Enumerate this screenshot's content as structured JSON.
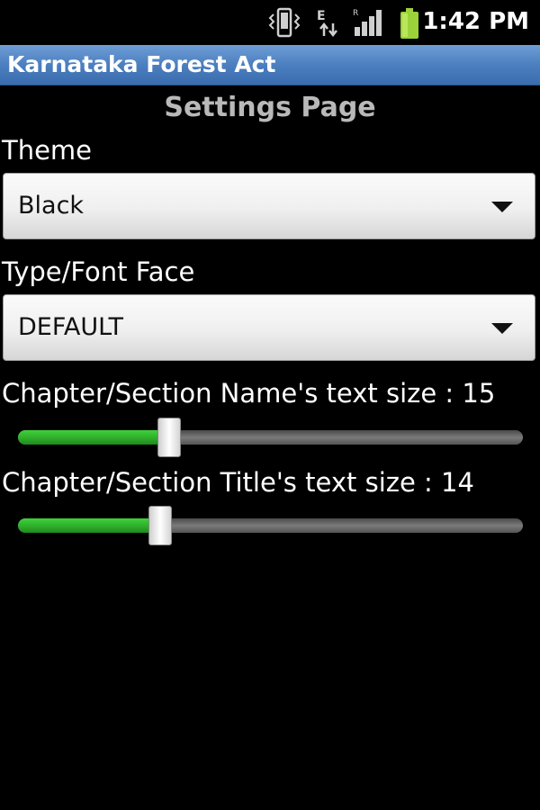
{
  "status_bar": {
    "time": "1:42 PM",
    "icons": [
      "vibrate-icon",
      "data-transfer-icon",
      "signal-icon",
      "battery-icon"
    ],
    "network_type_label": "E",
    "roaming_label": "R"
  },
  "app": {
    "title": "Karnataka Forest Act"
  },
  "page": {
    "heading": "Settings Page"
  },
  "theme": {
    "label": "Theme",
    "selected": "Black"
  },
  "font_face": {
    "label": "Type/Font Face",
    "selected": "DEFAULT"
  },
  "name_text_size": {
    "label": "Chapter/Section Name's text size : 15",
    "level_fraction": 0.3
  },
  "title_text_size": {
    "label": "Chapter/Section Title's text size : 14",
    "level_fraction": 0.282
  },
  "colors": {
    "title_bar": "#4c7fc0",
    "slider_fill": "#2fae2c",
    "heading_text": "#b9b9b9"
  }
}
